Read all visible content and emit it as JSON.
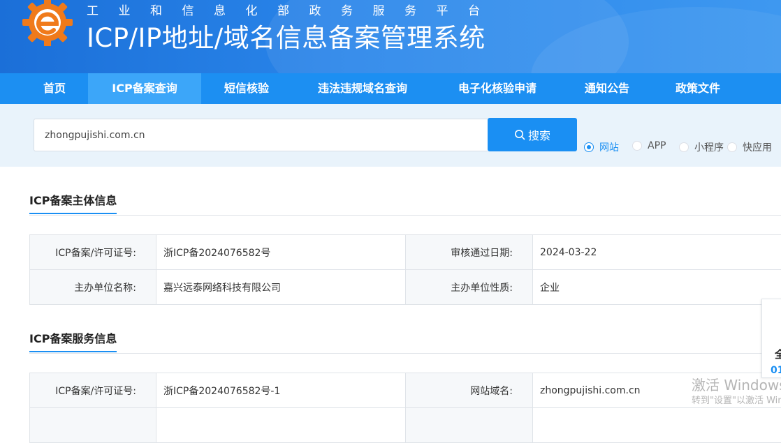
{
  "header": {
    "org_name": "工业和信息化部政务服务平台",
    "system_title": "ICP/IP地址/域名信息备案管理系统",
    "logo_icon": "gear-logo-icon",
    "brand_color": "#1b6fd8"
  },
  "nav": {
    "items": [
      {
        "label": "首页"
      },
      {
        "label": "ICP备案查询",
        "active": true
      },
      {
        "label": "短信核验"
      },
      {
        "label": "违法违规域名查询"
      },
      {
        "label": "电子化核验申请"
      },
      {
        "label": "通知公告"
      },
      {
        "label": "政策文件"
      }
    ]
  },
  "search": {
    "value": "zhongpujishi.com.cn",
    "button_label": "搜索",
    "button_icon": "search-icon",
    "types": [
      {
        "label": "网站",
        "checked": true
      },
      {
        "label": "APP"
      },
      {
        "label": "小程序"
      },
      {
        "label": "快应用"
      }
    ]
  },
  "subject_section": {
    "title": "ICP备案主体信息",
    "rows": [
      [
        {
          "label": "ICP备案/许可证号:",
          "value": "浙ICP备2024076582号"
        },
        {
          "label": "审核通过日期:",
          "value": "2024-03-22"
        }
      ],
      [
        {
          "label": "主办单位名称:",
          "value": "嘉兴远泰网络科技有限公司"
        },
        {
          "label": "主办单位性质:",
          "value": "企业"
        }
      ]
    ]
  },
  "service_section": {
    "title": "ICP备案服务信息",
    "rows": [
      [
        {
          "label": "ICP备案/许可证号:",
          "value": "浙ICP备2024076582号-1"
        },
        {
          "label": "网站域名:",
          "value": "zhongpujishi.com.cn"
        }
      ]
    ]
  },
  "side_widget": {
    "char": "全",
    "number": "01"
  },
  "watermark": {
    "line1": "激活 Windows",
    "line2": "转到\"设置\"以激活 Windows"
  },
  "colors": {
    "accent": "#1a8ff3",
    "nav_bg": "#1c8ff2",
    "nav_active": "#3ca6f9",
    "search_band": "#e9f3fb"
  }
}
